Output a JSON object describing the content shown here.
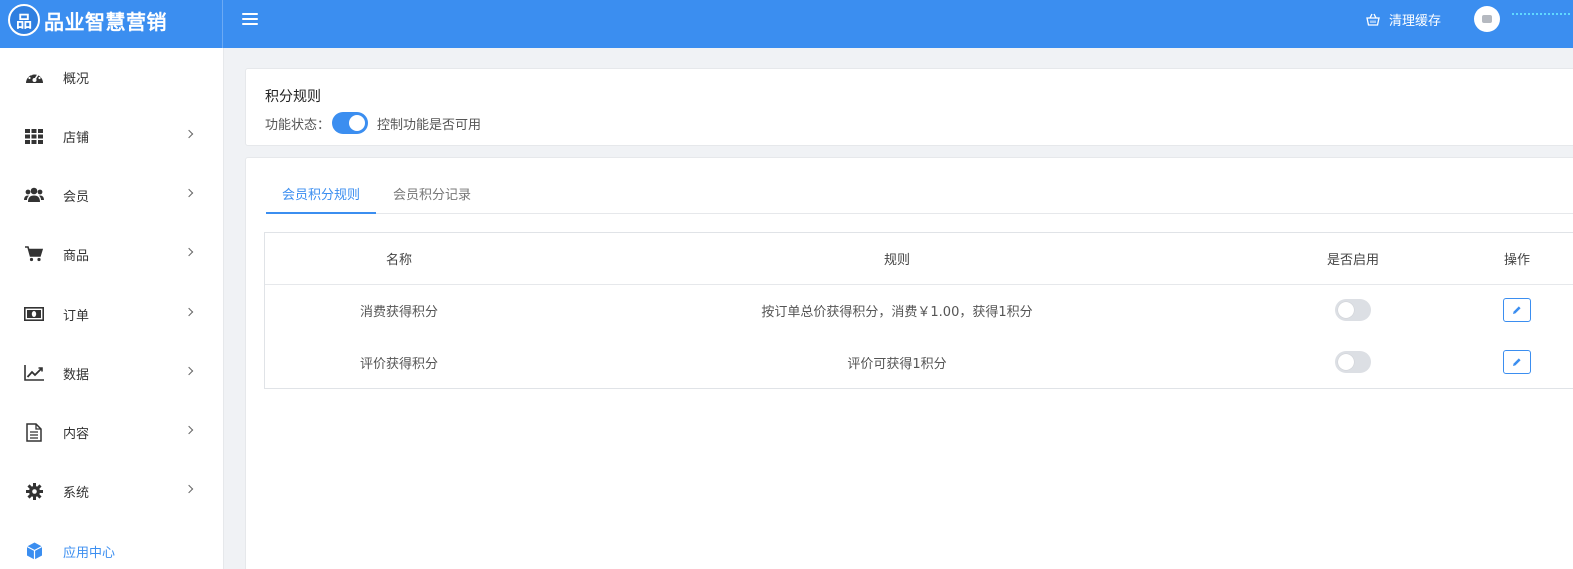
{
  "header": {
    "logo_char": "品",
    "app_name": "品业智慧营销",
    "clear_cache_label": "清理缓存"
  },
  "sidebar": {
    "items": [
      {
        "label": "概况",
        "icon": "dashboard-icon",
        "has_arrow": false
      },
      {
        "label": "店铺",
        "icon": "grid-icon",
        "has_arrow": true
      },
      {
        "label": "会员",
        "icon": "users-icon",
        "has_arrow": true
      },
      {
        "label": "商品",
        "icon": "cart-icon",
        "has_arrow": true
      },
      {
        "label": "订单",
        "icon": "money-icon",
        "has_arrow": true
      },
      {
        "label": "数据",
        "icon": "line-chart-icon",
        "has_arrow": true
      },
      {
        "label": "内容",
        "icon": "document-icon",
        "has_arrow": true
      },
      {
        "label": "系统",
        "icon": "gear-icon",
        "has_arrow": true
      },
      {
        "label": "应用中心",
        "icon": "cube-icon",
        "has_arrow": false,
        "active": true
      }
    ]
  },
  "rules_card": {
    "title": "积分规则",
    "status_label": "功能状态：",
    "status_on": true,
    "status_hint": "控制功能是否可用"
  },
  "tabs": [
    {
      "label": "会员积分规则",
      "active": true
    },
    {
      "label": "会员积分记录",
      "active": false
    }
  ],
  "table": {
    "columns": [
      "名称",
      "规则",
      "是否启用",
      "操作"
    ],
    "rows": [
      {
        "name": "消费获得积分",
        "rule": "按订单总价获得积分，消费￥1.00，获得1积分",
        "enabled": false
      },
      {
        "name": "评价获得积分",
        "rule": "评价可获得1积分",
        "enabled": false
      }
    ]
  },
  "colors": {
    "primary": "#3b8ef0",
    "switch_off": "#dcdfe4"
  }
}
